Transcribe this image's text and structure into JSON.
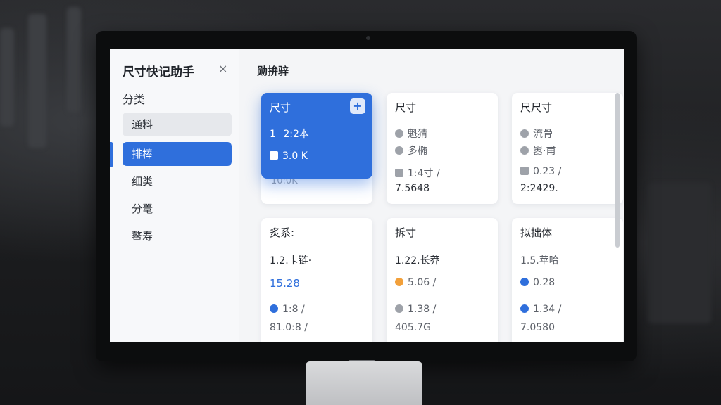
{
  "sidebar": {
    "app_title": "尺寸快记助手",
    "close_icon": "×",
    "section_label": "分类",
    "items": [
      {
        "label": "通料",
        "state": "muted"
      },
      {
        "label": "排棒",
        "state": "active"
      },
      {
        "label": "细类",
        "state": "normal"
      },
      {
        "label": "分鼍",
        "state": "normal"
      },
      {
        "label": "鳌寿",
        "state": "normal"
      }
    ]
  },
  "main": {
    "title": "勋拚骍",
    "add_icon": "+",
    "cards": [
      {
        "title": "尺寸",
        "rows": [
          "2:2本",
          "3.0 K"
        ],
        "row_icon_1": "1",
        "footer": "10:0K"
      },
      {
        "title": "尺寸",
        "rows": [
          "魁猜",
          "多椭"
        ],
        "values": [
          "1:4寸  /",
          "7.5648"
        ]
      },
      {
        "title": "尺尺寸",
        "rows": [
          "流骨",
          "嚣·甫"
        ],
        "values": [
          "0.23  /",
          "2:2429."
        ]
      },
      {
        "title": "炙系:",
        "rows": [
          "1.2.卡链·",
          "15.28",
          "1:8    /",
          "81.0:8  /"
        ]
      },
      {
        "title": "拆寸",
        "rows": [
          "1.22.长莽",
          "5.06 /",
          "1.38    /",
          "405.7G"
        ]
      },
      {
        "title": "拟拙体",
        "rows": [
          "1.5.苹哈",
          "0.28",
          "1.34    /",
          "7.0580"
        ]
      }
    ]
  },
  "colors": {
    "accent": "#2f6fdc",
    "text": "#1f2329",
    "muted_text": "#5d6169"
  }
}
